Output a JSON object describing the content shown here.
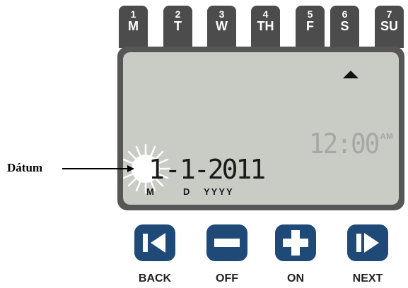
{
  "days": [
    {
      "num": "1",
      "abbr": "M"
    },
    {
      "num": "2",
      "abbr": "T"
    },
    {
      "num": "3",
      "abbr": "W"
    },
    {
      "num": "4",
      "abbr": "TH"
    },
    {
      "num": "5",
      "abbr": "F"
    },
    {
      "num": "6",
      "abbr": "S"
    },
    {
      "num": "7",
      "abbr": "SU"
    }
  ],
  "display": {
    "clock_time": "12:00",
    "clock_ampm": "AM",
    "date_month": "1-",
    "date_rest": "1-2011",
    "sub_month": "M",
    "sub_day": "D",
    "sub_year": "YYYY"
  },
  "annotation": {
    "label": "Dátum"
  },
  "buttons": {
    "back": "BACK",
    "off": "OFF",
    "on": "ON",
    "next": "NEXT"
  },
  "colors": {
    "tab": "#4c4c4c",
    "lcd_frame": "#565656",
    "lcd_screen": "#c9cbc5",
    "button": "#1f4a78"
  },
  "icons": {
    "back": "back-step-icon",
    "off": "minus-icon",
    "on": "plus-icon",
    "next": "next-step-icon",
    "indicator": "triangle-up-icon"
  }
}
